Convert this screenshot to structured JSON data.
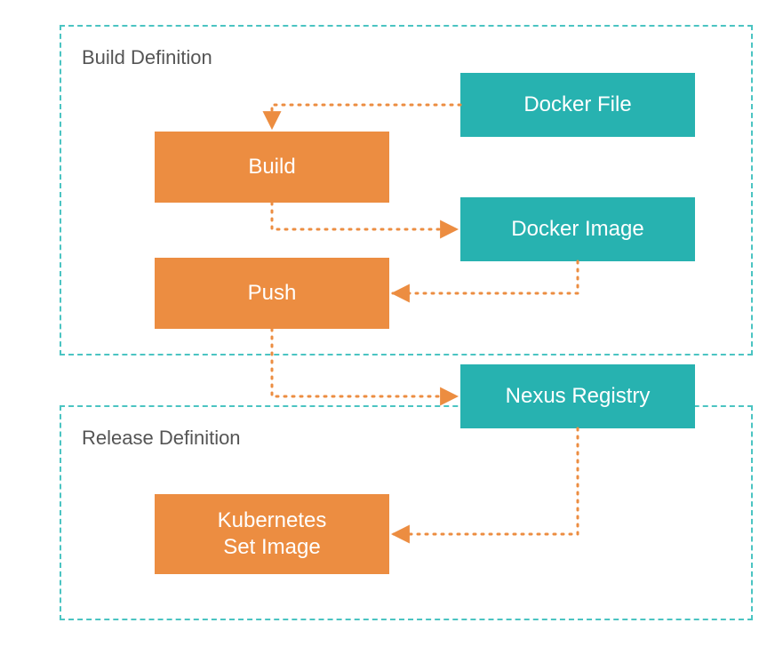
{
  "colors": {
    "orange": "#ec8d41",
    "teal": "#27b2b0",
    "tealBorder": "#4bc4c2",
    "groupText": "#555555",
    "connector": "#ec8d41"
  },
  "groups": {
    "build": {
      "label": "Build Definition"
    },
    "release": {
      "label": "Release Definition"
    }
  },
  "nodes": {
    "dockerFile": {
      "label": "Docker File"
    },
    "build": {
      "label": "Build"
    },
    "dockerImage": {
      "label": "Docker Image"
    },
    "push": {
      "label": "Push"
    },
    "nexus": {
      "label": "Nexus Registry"
    },
    "k8s": {
      "label": "Kubernetes\nSet Image"
    }
  }
}
